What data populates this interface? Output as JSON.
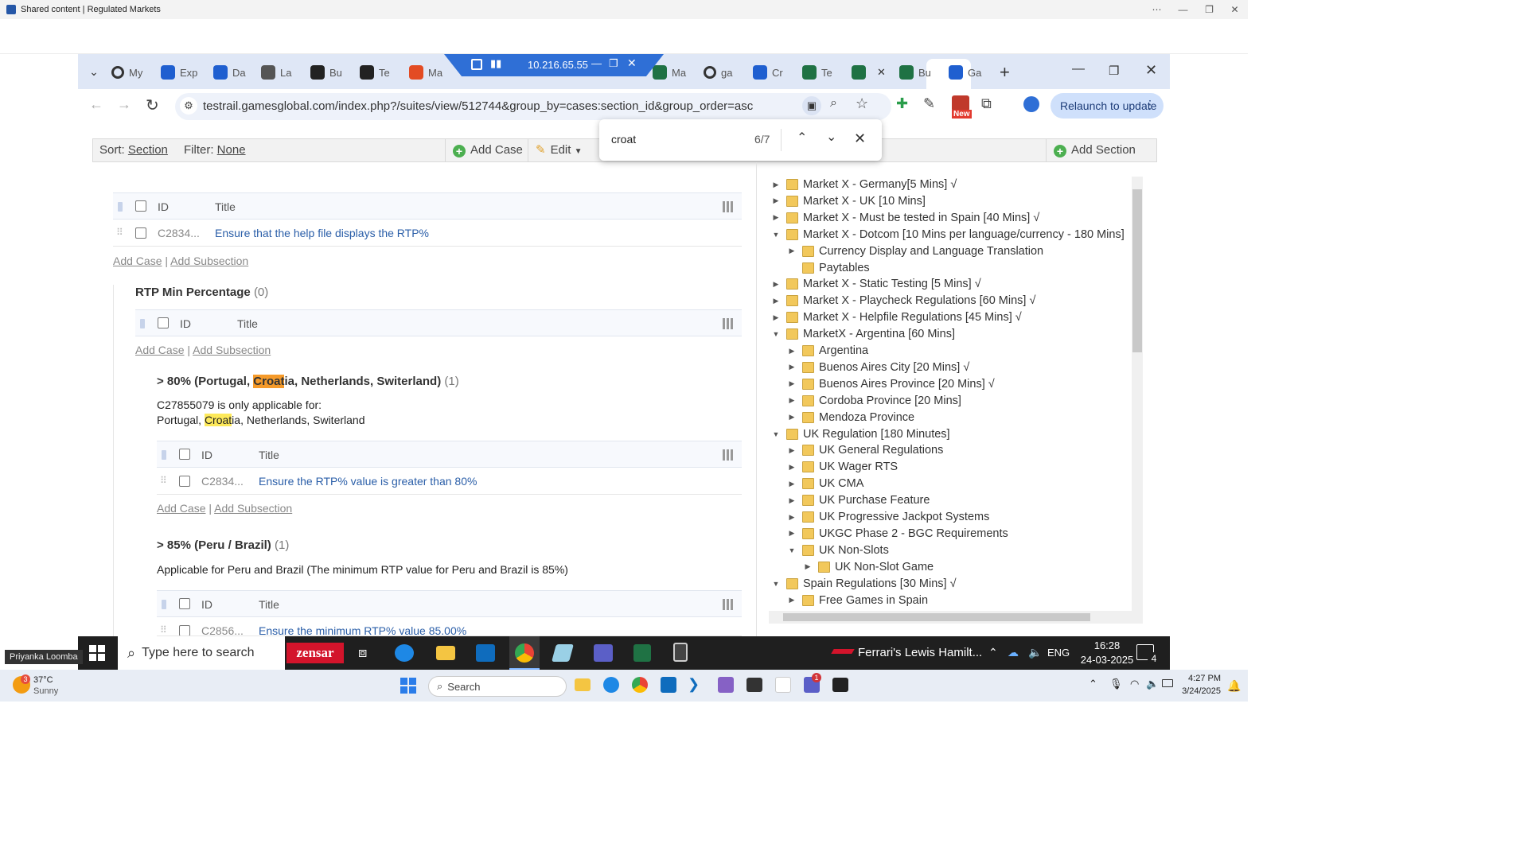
{
  "outer_window": {
    "title": "Shared content | Regulated Markets"
  },
  "browser": {
    "tabs": [
      {
        "label": "My",
        "icon": "circle-icon",
        "color": "#333333"
      },
      {
        "label": "Exp",
        "icon": "confluence-icon",
        "color": "#1f5fd0"
      },
      {
        "label": "Da",
        "icon": "confluence-icon",
        "color": "#1f5fd0"
      },
      {
        "label": "La",
        "icon": "atlas-icon",
        "color": "#555555"
      },
      {
        "label": "Bu",
        "icon": "bug-icon",
        "color": "#222222"
      },
      {
        "label": "Te",
        "icon": "target-icon",
        "color": "#222222"
      },
      {
        "label": "Ma",
        "icon": "microsoft-icon",
        "color": "#e34b23"
      },
      {
        "label": "Ma",
        "icon": "excel-icon",
        "color": "#1f7244"
      },
      {
        "label": "ga",
        "icon": "circle-icon",
        "color": "#333333"
      },
      {
        "label": "Cr",
        "icon": "confluence-icon",
        "color": "#1f5fd0"
      },
      {
        "label": "Te",
        "icon": "testrail-icon",
        "color": "#1f7244"
      },
      {
        "label": "",
        "icon": "testrail-icon",
        "color": "#1f7244"
      },
      {
        "label": "Bu",
        "icon": "testrail-icon",
        "color": "#1f7244"
      },
      {
        "label": "Ga",
        "icon": "confluence-icon",
        "color": "#1f5fd0"
      }
    ],
    "rdp_ip": "10.216.65.55",
    "url": "testrail.gamesglobal.com/index.php?/suites/view/512744&group_by=cases:section_id&group_order=asc",
    "relaunch_label": "Relaunch to update",
    "new_badge": "New"
  },
  "toolbar": {
    "sort_label": "Sort:",
    "sort_value": "Section",
    "filter_label": "Filter:",
    "filter_value": "None",
    "add_case": "Add Case",
    "edit": "Edit",
    "add_section": "Add Section"
  },
  "find": {
    "query": "croat",
    "count": "6/7"
  },
  "content": {
    "table_id": "ID",
    "table_title": "Title",
    "add_case": "Add Case",
    "add_subsection": "Add Subsection",
    "sep": "|",
    "row1": {
      "id": "C2834...",
      "title": "Ensure that the help file displays the RTP%"
    },
    "rtp_min": {
      "title": "RTP Min Percentage",
      "count": "(0)"
    },
    "sec80": {
      "t1": "> 80% (Portugal, ",
      "t_hl": "Croat",
      "t2": "ia, Netherlands, Switerland)",
      "count": "(1)",
      "desc1": "C27855079 is only applicable for:",
      "desc2a": "Portugal, ",
      "desc2_hl": "Croat",
      "desc2b": "ia, Netherlands, Switerland",
      "row": {
        "id": "C2834...",
        "title": "Ensure the RTP% value is greater than 80%"
      }
    },
    "sec85": {
      "title": "> 85% (Peru / Brazil)",
      "count": "(1)",
      "desc": "Applicable for Peru and Brazil (The minimum RTP value for Peru and Brazil is 85%)",
      "row": {
        "id": "C2856...",
        "title": "Ensure the minimum RTP% value 85.00%"
      }
    }
  },
  "tree": [
    {
      "label": "Market X - Germany[5 Mins] √",
      "level": 0,
      "arrow": "▶"
    },
    {
      "label": "Market X - UK [10 Mins]",
      "level": 0,
      "arrow": "▶"
    },
    {
      "label": "Market X - Must be tested in Spain [40 Mins] √",
      "level": 0,
      "arrow": "▶"
    },
    {
      "label": "Market X - Dotcom [10 Mins per language/currency - 180 Mins]",
      "level": 0,
      "arrow": "▼"
    },
    {
      "label": "Currency Display and Language Translation",
      "level": 1,
      "arrow": "▶"
    },
    {
      "label": "Paytables",
      "level": 1,
      "arrow": ""
    },
    {
      "label": "Market X - Static Testing [5 Mins] √",
      "level": 0,
      "arrow": "▶"
    },
    {
      "label": "Market X - Playcheck Regulations [60 Mins] √",
      "level": 0,
      "arrow": "▶"
    },
    {
      "label": "Market X - Helpfile Regulations [45 Mins] √",
      "level": 0,
      "arrow": "▶"
    },
    {
      "label": "MarketX - Argentina [60 Mins]",
      "level": 0,
      "arrow": "▼"
    },
    {
      "label": "Argentina",
      "level": 1,
      "arrow": "▶"
    },
    {
      "label": "Buenos Aires City [20 Mins] √",
      "level": 1,
      "arrow": "▶"
    },
    {
      "label": "Buenos Aires Province [20 Mins] √",
      "level": 1,
      "arrow": "▶"
    },
    {
      "label": "Cordoba Province [20 Mins]",
      "level": 1,
      "arrow": "▶"
    },
    {
      "label": "Mendoza Province",
      "level": 1,
      "arrow": "▶"
    },
    {
      "label": "UK Regulation [180 Minutes]",
      "level": 0,
      "arrow": "▼"
    },
    {
      "label": "UK General Regulations",
      "level": 1,
      "arrow": "▶"
    },
    {
      "label": "UK Wager RTS",
      "level": 1,
      "arrow": "▶"
    },
    {
      "label": "UK CMA",
      "level": 1,
      "arrow": "▶"
    },
    {
      "label": "UK Purchase Feature",
      "level": 1,
      "arrow": "▶"
    },
    {
      "label": "UK Progressive Jackpot Systems",
      "level": 1,
      "arrow": "▶"
    },
    {
      "label": "UKGC Phase 2 - BGC Requirements",
      "level": 1,
      "arrow": "▶"
    },
    {
      "label": "UK Non-Slots",
      "level": 1,
      "arrow": "▼"
    },
    {
      "label": "UK Non-Slot Game",
      "level": 2,
      "arrow": "▶"
    },
    {
      "label": "Spain Regulations [30 Mins] √",
      "level": 0,
      "arrow": "▼"
    },
    {
      "label": "Free Games in Spain",
      "level": 1,
      "arrow": "▶"
    }
  ],
  "inner_taskbar": {
    "search_placeholder": "Type here to search",
    "zensar": "zensar",
    "news": "Ferrari's Lewis Hamilt...",
    "lang": "ENG",
    "time": "16:28",
    "date": "24-03-2025",
    "notif": "4",
    "presenter": "Priyanka Loomba"
  },
  "outer_taskbar": {
    "weather_temp": "37°C",
    "weather_desc": "Sunny",
    "weather_badge": "3",
    "search": "Search",
    "time": "4:27 PM",
    "date": "3/24/2025",
    "badge": "1"
  }
}
